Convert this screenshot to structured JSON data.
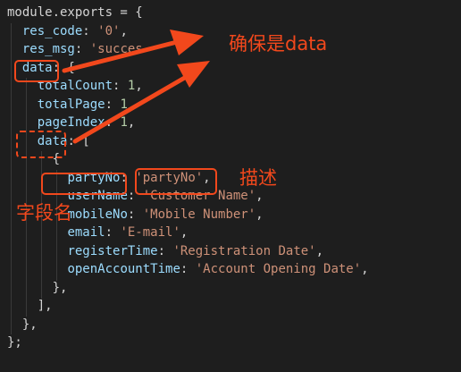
{
  "editor": {
    "background": "#1e1e1e",
    "colors": {
      "key": "#9cdcfe",
      "string": "#ce9178",
      "number": "#b5cea8",
      "punct": "#d4d4d4",
      "annotation": "#f2481c"
    },
    "lines": [
      [
        {
          "t": "p",
          "v": "module.exports = {"
        }
      ],
      [
        {
          "t": "p",
          "v": "  "
        },
        {
          "t": "k",
          "v": "res_code"
        },
        {
          "t": "p",
          "v": ": "
        },
        {
          "t": "s",
          "v": "'0'"
        },
        {
          "t": "p",
          "v": ","
        }
      ],
      [
        {
          "t": "p",
          "v": "  "
        },
        {
          "t": "k",
          "v": "res_msg"
        },
        {
          "t": "p",
          "v": ": "
        },
        {
          "t": "s",
          "v": "'succes"
        }
      ],
      [
        {
          "t": "p",
          "v": "  "
        },
        {
          "t": "k",
          "v": "data"
        },
        {
          "t": "p",
          "v": ": {"
        }
      ],
      [
        {
          "t": "p",
          "v": "    "
        },
        {
          "t": "k",
          "v": "totalCount"
        },
        {
          "t": "p",
          "v": ": "
        },
        {
          "t": "n",
          "v": "1"
        },
        {
          "t": "p",
          "v": ","
        }
      ],
      [
        {
          "t": "p",
          "v": "    "
        },
        {
          "t": "k",
          "v": "totalPage"
        },
        {
          "t": "p",
          "v": ": "
        },
        {
          "t": "n",
          "v": "1"
        }
      ],
      [
        {
          "t": "p",
          "v": "    "
        },
        {
          "t": "k",
          "v": "pageIndex"
        },
        {
          "t": "p",
          "v": ": "
        },
        {
          "t": "n",
          "v": "1"
        },
        {
          "t": "p",
          "v": ","
        }
      ],
      [
        {
          "t": "p",
          "v": "    "
        },
        {
          "t": "k",
          "v": "data"
        },
        {
          "t": "p",
          "v": ": ["
        }
      ],
      [
        {
          "t": "p",
          "v": "      {"
        }
      ],
      [
        {
          "t": "p",
          "v": "        "
        },
        {
          "t": "k",
          "v": "partyNo"
        },
        {
          "t": "p",
          "v": ": "
        },
        {
          "t": "s",
          "v": "'partyNo'"
        },
        {
          "t": "p",
          "v": ","
        }
      ],
      [
        {
          "t": "p",
          "v": "        "
        },
        {
          "t": "k",
          "v": "userName"
        },
        {
          "t": "p",
          "v": ": "
        },
        {
          "t": "s",
          "v": "'Customer Name'"
        },
        {
          "t": "p",
          "v": ","
        }
      ],
      [
        {
          "t": "p",
          "v": "        "
        },
        {
          "t": "k",
          "v": "mobileNo"
        },
        {
          "t": "p",
          "v": ": "
        },
        {
          "t": "s",
          "v": "'Mobile Number'"
        },
        {
          "t": "p",
          "v": ","
        }
      ],
      [
        {
          "t": "p",
          "v": "        "
        },
        {
          "t": "k",
          "v": "email"
        },
        {
          "t": "p",
          "v": ": "
        },
        {
          "t": "s",
          "v": "'E-mail'"
        },
        {
          "t": "p",
          "v": ","
        }
      ],
      [
        {
          "t": "p",
          "v": "        "
        },
        {
          "t": "k",
          "v": "registerTime"
        },
        {
          "t": "p",
          "v": ": "
        },
        {
          "t": "s",
          "v": "'Registration Date'"
        },
        {
          "t": "p",
          "v": ","
        }
      ],
      [
        {
          "t": "p",
          "v": "        "
        },
        {
          "t": "k",
          "v": "openAccountTime"
        },
        {
          "t": "p",
          "v": ": "
        },
        {
          "t": "s",
          "v": "'Account Opening Date'"
        },
        {
          "t": "p",
          "v": ","
        }
      ],
      [
        {
          "t": "p",
          "v": "      },"
        }
      ],
      [
        {
          "t": "p",
          "v": "    ],"
        }
      ],
      [
        {
          "t": "p",
          "v": "  },"
        }
      ],
      [
        {
          "t": "p",
          "v": "};"
        }
      ]
    ]
  },
  "annotations": {
    "ensure_data": "确保是data",
    "describe": "描述",
    "field_name": "字段名"
  }
}
